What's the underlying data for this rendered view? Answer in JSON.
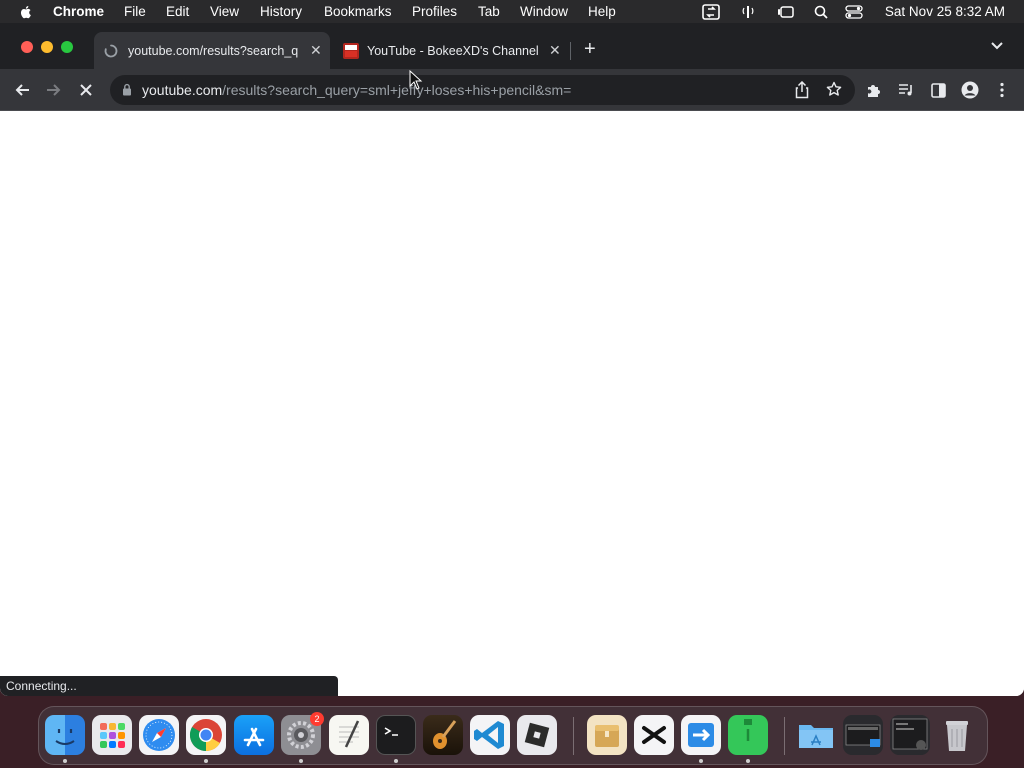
{
  "menubar": {
    "app": "Chrome",
    "items": [
      "File",
      "Edit",
      "View",
      "History",
      "Bookmarks",
      "Profiles",
      "Tab",
      "Window",
      "Help"
    ],
    "clock": "Sat Nov 25  8:32 AM"
  },
  "tabs": [
    {
      "title": "youtube.com/results?search_q",
      "active": true
    },
    {
      "title": "YouTube - BokeeXD's Channel",
      "active": false
    }
  ],
  "toolbar": {
    "url_host": "youtube.com",
    "url_path": "/results?search_query=sml+jeffy+loses+his+pencil&sm="
  },
  "status": {
    "text": "Connecting..."
  },
  "dock": {
    "settings_badge": "2"
  },
  "colors": {
    "tabstrip": "#202124",
    "toolbar": "#35363a",
    "traffic_red": "#ff5f57",
    "traffic_yellow": "#febc2e",
    "traffic_green": "#28c840"
  }
}
